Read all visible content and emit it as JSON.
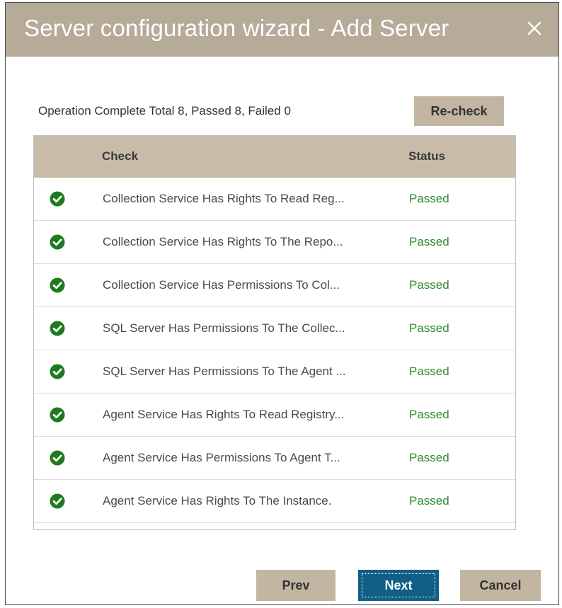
{
  "dialog": {
    "title": "Server configuration wizard - Add Server",
    "close_icon": "close-icon"
  },
  "summary": "Operation Complete Total 8, Passed 8, Failed 0",
  "buttons": {
    "recheck": "Re-check",
    "prev": "Prev",
    "next": "Next",
    "cancel": "Cancel"
  },
  "table": {
    "columns": [
      "Check",
      "Status"
    ],
    "rows": [
      {
        "icon": "check-circle-icon",
        "check": "Collection Service Has Rights To Read Reg...",
        "status": "Passed"
      },
      {
        "icon": "check-circle-icon",
        "check": "Collection Service Has Rights To The Repo...",
        "status": "Passed"
      },
      {
        "icon": "check-circle-icon",
        "check": "Collection Service Has Permissions To Col...",
        "status": "Passed"
      },
      {
        "icon": "check-circle-icon",
        "check": "SQL Server Has Permissions To The Collec...",
        "status": "Passed"
      },
      {
        "icon": "check-circle-icon",
        "check": "SQL Server Has Permissions To The Agent ...",
        "status": "Passed"
      },
      {
        "icon": "check-circle-icon",
        "check": "Agent Service Has Rights To Read Registry...",
        "status": "Passed"
      },
      {
        "icon": "check-circle-icon",
        "check": "Agent Service Has Permissions To Agent T...",
        "status": "Passed"
      },
      {
        "icon": "check-circle-icon",
        "check": "Agent Service Has Rights To The Instance.",
        "status": "Passed"
      }
    ]
  },
  "colors": {
    "titlebar": "#b6aa98",
    "header": "#c8bca9",
    "button": "#c2b6a3",
    "primary": "#0f5f86",
    "passed": "#2e8b2e",
    "check_icon": "#1e7a1e"
  }
}
